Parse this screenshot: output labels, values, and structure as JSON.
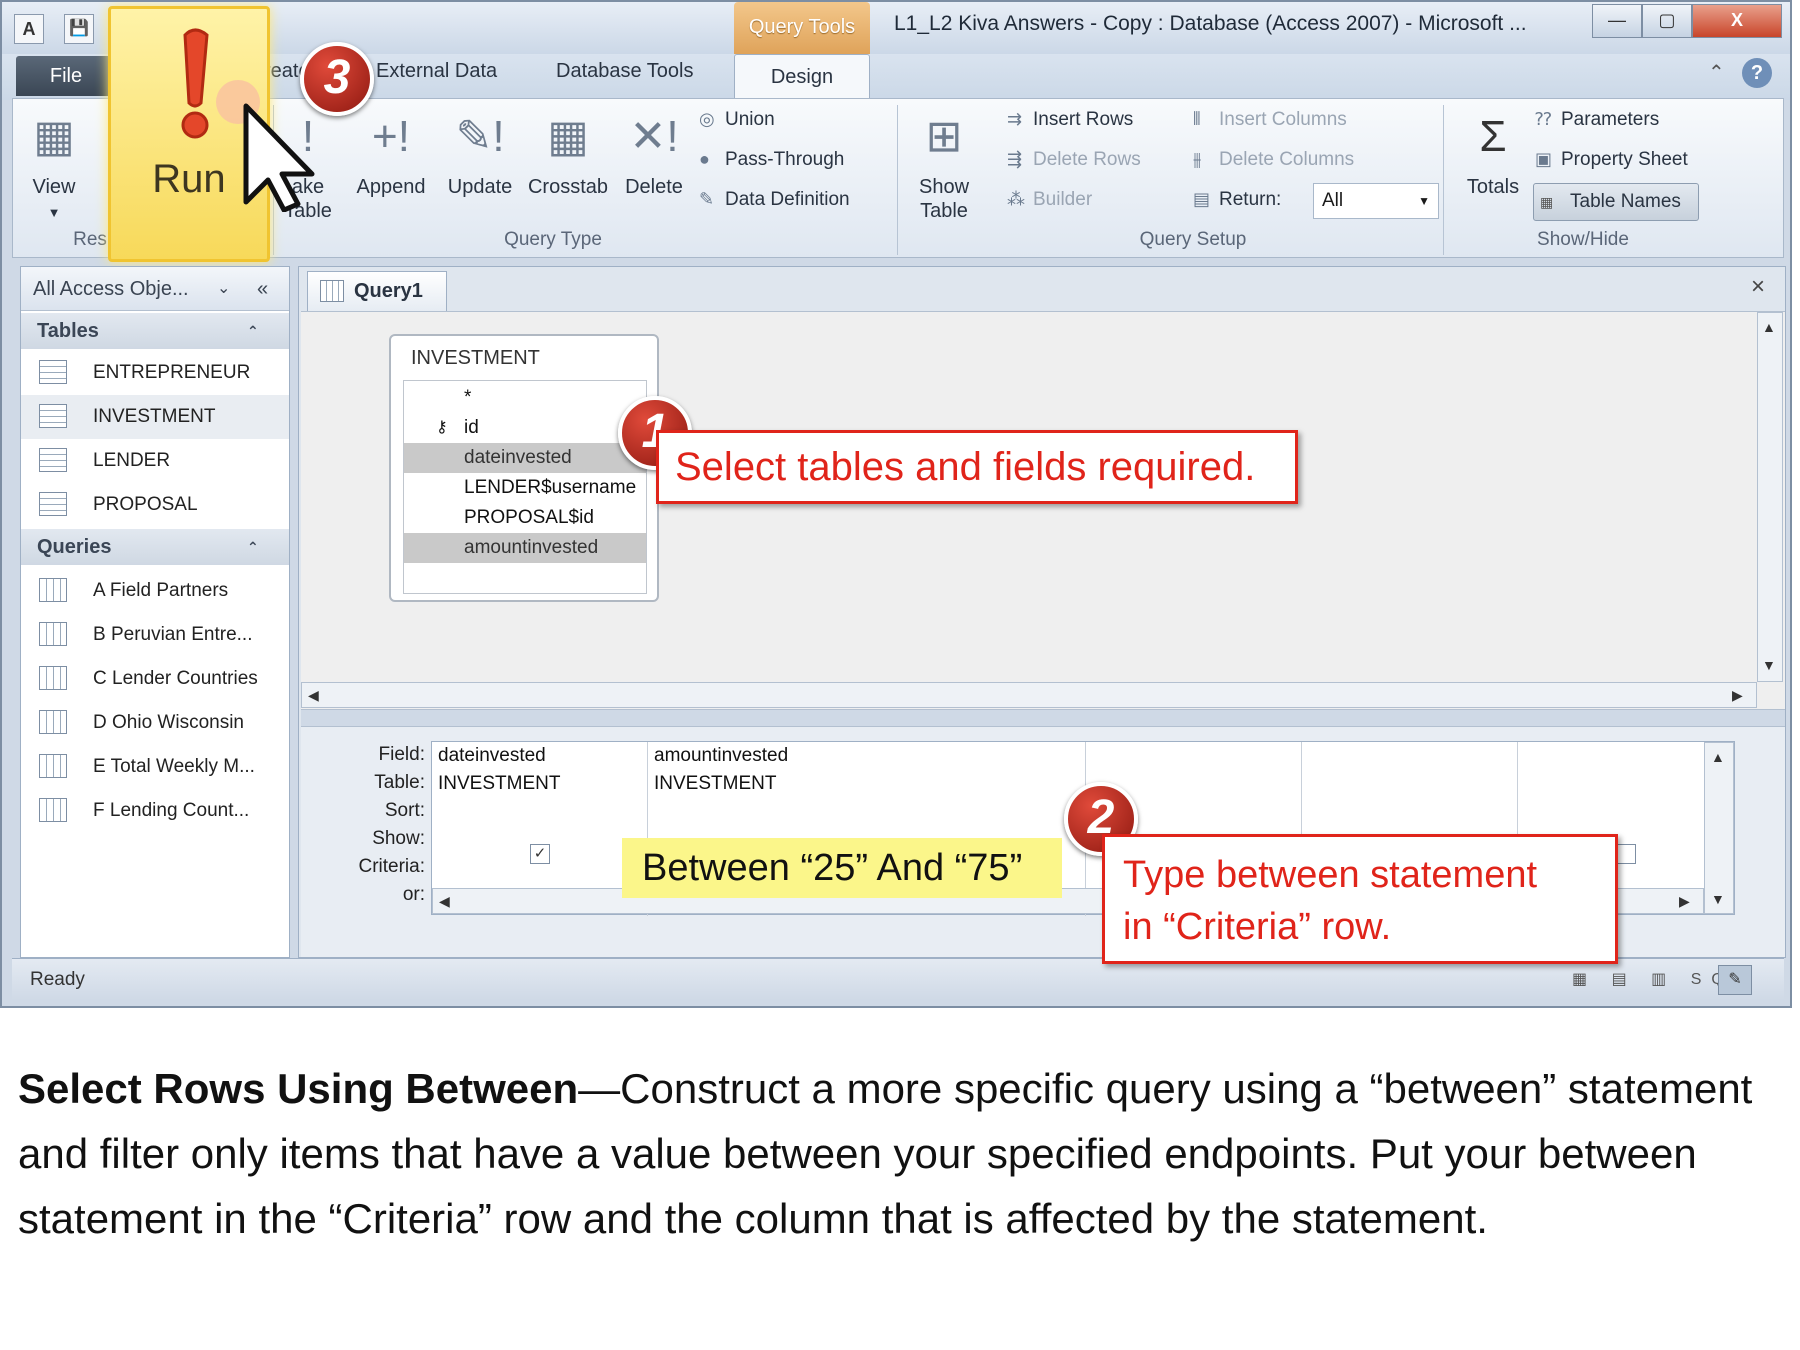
{
  "window": {
    "title": "L1_L2 Kiva Answers - Copy : Database (Access 2007)  -  Microsoft ...",
    "context_tab": "Query Tools",
    "qat": [
      "A",
      "💾"
    ],
    "controls": [
      "—",
      "▢",
      "X"
    ]
  },
  "ribbon": {
    "file_tab": "File",
    "tabs": [
      "reate",
      "External Data",
      "Database Tools",
      "Design"
    ],
    "groups": {
      "results": {
        "label": "Res",
        "view": "View",
        "run": "Run"
      },
      "query_type": {
        "label": "Query Type",
        "make_table": [
          "ake",
          "Table"
        ],
        "append": "Append",
        "update": "Update",
        "crosstab": "Crosstab",
        "delete": "Delete",
        "union": "Union",
        "pass_through": "Pass-Through",
        "data_definition": "Data Definition"
      },
      "query_setup": {
        "label": "Query Setup",
        "show_table": [
          "Show",
          "Table"
        ],
        "insert_rows": "Insert Rows",
        "delete_rows": "Delete Rows",
        "builder": "Builder",
        "insert_columns": "Insert Columns",
        "delete_columns": "Delete Columns",
        "return_label": "Return:",
        "return_value": "All"
      },
      "show_hide": {
        "label": "Show/Hide",
        "totals": "Totals",
        "parameters": "Parameters",
        "property_sheet": "Property Sheet",
        "table_names": "Table Names"
      }
    }
  },
  "nav": {
    "header": "All Access Obje...",
    "tables_label": "Tables",
    "tables": [
      "ENTREPRENEUR",
      "INVESTMENT",
      "LENDER",
      "PROPOSAL"
    ],
    "queries_label": "Queries",
    "queries": [
      "A Field Partners",
      "B Peruvian Entre...",
      "C Lender Countries",
      "D Ohio Wisconsin",
      "E Total Weekly M...",
      "F Lending Count..."
    ]
  },
  "document": {
    "tab": "Query1",
    "table_box": {
      "name": "INVESTMENT",
      "fields": [
        "*",
        "id",
        "dateinvested",
        "LENDER$username",
        "PROPOSAL$id",
        "amountinvested"
      ]
    },
    "grid": {
      "row_labels": [
        "Field:",
        "Table:",
        "Sort:",
        "Show:",
        "Criteria:",
        "or:"
      ],
      "columns": [
        {
          "field": "dateinvested",
          "table": "INVESTMENT"
        },
        {
          "field": "amountinvested",
          "table": "INVESTMENT"
        }
      ]
    }
  },
  "status": "Ready",
  "annotations": {
    "badge1": "1",
    "badge2": "2",
    "badge3": "3",
    "callout1": "Select tables and fields required.",
    "callout2": [
      "Type between statement",
      "in “Criteria” row."
    ],
    "criteria_text": "Between “25” And “75”"
  },
  "caption": {
    "bold": "Select Rows Using Between",
    "text": "—Construct a more specific query using a “between” statement and filter only items that have a value between your specified endpoints.  Put your between statement in the “Criteria” row and the column that is affected by the statement."
  },
  "colors": {
    "annotation_red": "#e0241a",
    "highlight_yellow": "#fbf68a",
    "run_highlight": "#f7d95a"
  }
}
